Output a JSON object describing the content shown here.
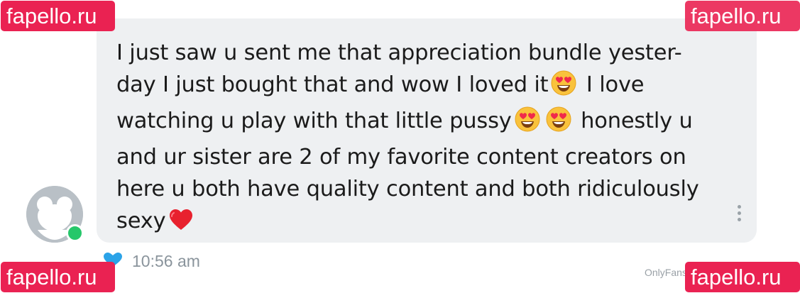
{
  "message": {
    "text_lines": [
      "I just saw u sent me that appreciation bundle yester-",
      "day I just bought that and wow I loved it",
      "I love",
      "watching u play with that little pussy",
      "honestly u",
      "and ur sister are 2 of my favorite content creators on",
      "here u both have quality content and both ridiculously",
      "sexy"
    ],
    "emojis": [
      "heart-eyes-emoji",
      "heart-eyes-emoji",
      "heart-eyes-emoji",
      "red-heart-emoji"
    ]
  },
  "footer": {
    "timestamp": "10:56 am",
    "platform_watermark": "OnlyFans"
  },
  "watermarks": {
    "top_left": "fapello.ru",
    "top_right": "fapello.ru",
    "bottom_left": "fapello.ru",
    "bottom_right": "fapello.ru"
  },
  "colors": {
    "bubble_bg": "#eef0f2",
    "online_status": "#26c76a",
    "like_icon": "#2ba3e8",
    "watermark_bg": "#ea2252"
  }
}
